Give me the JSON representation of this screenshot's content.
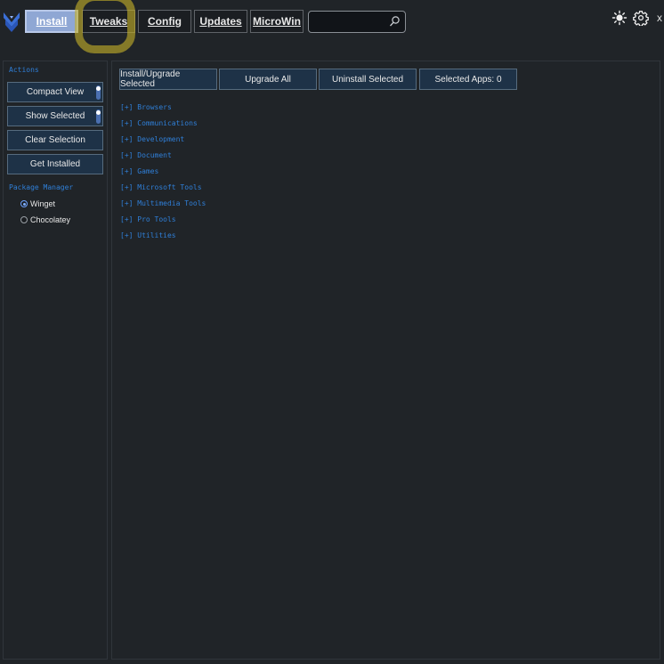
{
  "nav": {
    "tabs": [
      {
        "label": "Install",
        "active": true
      },
      {
        "label": "Tweaks",
        "active": false
      },
      {
        "label": "Config",
        "active": false
      },
      {
        "label": "Updates",
        "active": false
      },
      {
        "label": "MicroWin",
        "active": false
      }
    ],
    "search": {
      "value": "",
      "placeholder": ""
    },
    "close_label": "x"
  },
  "sidebar": {
    "actions_label": "Actions",
    "buttons": [
      {
        "label": "Compact View",
        "toggle": true
      },
      {
        "label": "Show Selected",
        "toggle": true
      },
      {
        "label": "Clear Selection",
        "toggle": false
      },
      {
        "label": "Get Installed",
        "toggle": false
      }
    ],
    "package_manager_label": "Package Manager",
    "package_managers": [
      {
        "label": "Winget",
        "checked": true
      },
      {
        "label": "Chocolatey",
        "checked": false
      }
    ]
  },
  "main": {
    "actions": [
      {
        "label": "Install/Upgrade Selected"
      },
      {
        "label": "Upgrade All"
      },
      {
        "label": "Uninstall Selected"
      },
      {
        "label": "Selected Apps: 0"
      }
    ],
    "categories": [
      "[+] Browsers",
      "[+] Communications",
      "[+] Development",
      "[+] Document",
      "[+] Games",
      "[+] Microsoft Tools",
      "[+] Multimedia Tools",
      "[+] Pro Tools",
      "[+] Utilities"
    ]
  },
  "icons": {
    "logo": "winutil-logo-icon",
    "search": "search-icon",
    "theme": "sun-icon",
    "settings": "gear-icon"
  },
  "colors": {
    "background": "#202428",
    "button_bg": "#1e3247",
    "active_tab": "#8fa7d4",
    "accent_text": "#2f7fd8",
    "highlight": "#c4b028"
  }
}
